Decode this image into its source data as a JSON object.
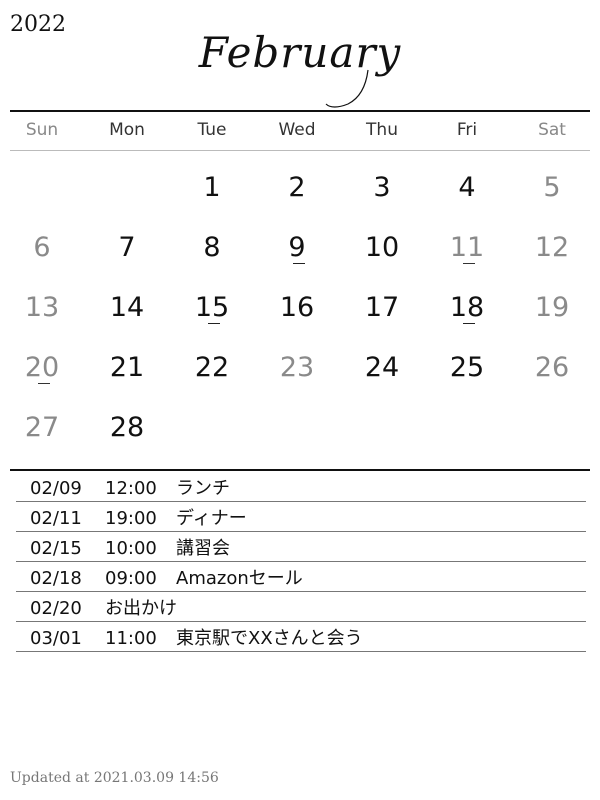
{
  "header": {
    "year": "2022",
    "month": "February"
  },
  "weekdays": [
    "Sun",
    "Mon",
    "Tue",
    "Wed",
    "Thu",
    "Fri",
    "Sat"
  ],
  "weekday_weekend_flags": [
    true,
    false,
    false,
    false,
    false,
    false,
    true
  ],
  "weeks": [
    [
      {
        "day": "",
        "muted": false,
        "event": false
      },
      {
        "day": "",
        "muted": false,
        "event": false
      },
      {
        "day": "1",
        "muted": false,
        "event": false
      },
      {
        "day": "2",
        "muted": false,
        "event": false
      },
      {
        "day": "3",
        "muted": false,
        "event": false
      },
      {
        "day": "4",
        "muted": false,
        "event": false
      },
      {
        "day": "5",
        "muted": true,
        "event": false
      }
    ],
    [
      {
        "day": "6",
        "muted": true,
        "event": false
      },
      {
        "day": "7",
        "muted": false,
        "event": false
      },
      {
        "day": "8",
        "muted": false,
        "event": false
      },
      {
        "day": "9",
        "muted": false,
        "event": true
      },
      {
        "day": "10",
        "muted": false,
        "event": false
      },
      {
        "day": "11",
        "muted": true,
        "event": true
      },
      {
        "day": "12",
        "muted": true,
        "event": false
      }
    ],
    [
      {
        "day": "13",
        "muted": true,
        "event": false
      },
      {
        "day": "14",
        "muted": false,
        "event": false
      },
      {
        "day": "15",
        "muted": false,
        "event": true
      },
      {
        "day": "16",
        "muted": false,
        "event": false
      },
      {
        "day": "17",
        "muted": false,
        "event": false
      },
      {
        "day": "18",
        "muted": false,
        "event": true
      },
      {
        "day": "19",
        "muted": true,
        "event": false
      }
    ],
    [
      {
        "day": "20",
        "muted": true,
        "event": true
      },
      {
        "day": "21",
        "muted": false,
        "event": false
      },
      {
        "day": "22",
        "muted": false,
        "event": false
      },
      {
        "day": "23",
        "muted": true,
        "event": false
      },
      {
        "day": "24",
        "muted": false,
        "event": false
      },
      {
        "day": "25",
        "muted": false,
        "event": false
      },
      {
        "day": "26",
        "muted": true,
        "event": false
      }
    ],
    [
      {
        "day": "27",
        "muted": true,
        "event": false
      },
      {
        "day": "28",
        "muted": false,
        "event": false
      },
      {
        "day": "",
        "muted": false,
        "event": false
      },
      {
        "day": "",
        "muted": false,
        "event": false
      },
      {
        "day": "",
        "muted": false,
        "event": false
      },
      {
        "day": "",
        "muted": false,
        "event": false
      },
      {
        "day": "",
        "muted": false,
        "event": false
      }
    ]
  ],
  "events": [
    {
      "date": "02/09",
      "time": "12:00",
      "title": "ランチ"
    },
    {
      "date": "02/11",
      "time": "19:00",
      "title": "ディナー"
    },
    {
      "date": "02/15",
      "time": "10:00",
      "title": "講習会"
    },
    {
      "date": "02/18",
      "time": "09:00",
      "title": "Amazonセール"
    },
    {
      "date": "02/20",
      "time": "",
      "title": "お出かけ"
    },
    {
      "date": "03/01",
      "time": "11:00",
      "title": "東京駅でXXさんと会う"
    }
  ],
  "footer": {
    "updated": "Updated at 2021.03.09 14:56"
  },
  "colors": {
    "text": "#111111",
    "muted": "#8a8a8a",
    "rule": "#111111",
    "row_rule": "#777777",
    "background": "#ffffff"
  }
}
